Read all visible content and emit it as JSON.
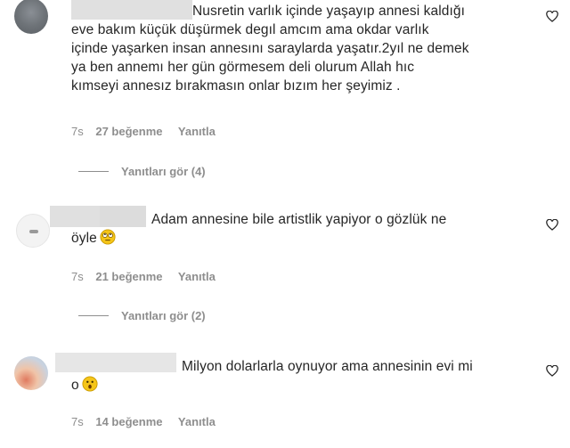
{
  "comments": [
    {
      "text": "Nusretin varlık içinde yaşayıp annesi kaldığı\neve bakım küçük düşürmek degıl amcım ama okdar varlık\niçinde yaşarken insan annesını saraylarda yaşatır.2yıl ne demek\nya ben annemı her gün görmesem deli olurum Allah hıc\nkımseyi annesız bırakmasın onlar bızım her şeyimiz .",
      "time": "7s",
      "likes": "27 beğenme",
      "reply": "Yanıtla",
      "view_replies": "Yanıtları gör (4)"
    },
    {
      "text": "Adam annesine bile artistlik yapiyor o gözlük ne\nöyle",
      "emoji": "rolling-eyes-emoji",
      "time": "7s",
      "likes": "21 beğenme",
      "reply": "Yanıtla",
      "view_replies": "Yanıtları gör (2)"
    },
    {
      "text": "Milyon dolarlarla oynuyor ama annesinin evi mi\no",
      "emoji": "astonished-emoji",
      "time": "7s",
      "likes": "14 beğenme",
      "reply": "Yanıtla"
    }
  ],
  "icons": {
    "like": "heart-outline-icon"
  },
  "colors": {
    "text": "#262626",
    "meta": "#8e8e8e",
    "redaction": "#e0e0e0"
  }
}
